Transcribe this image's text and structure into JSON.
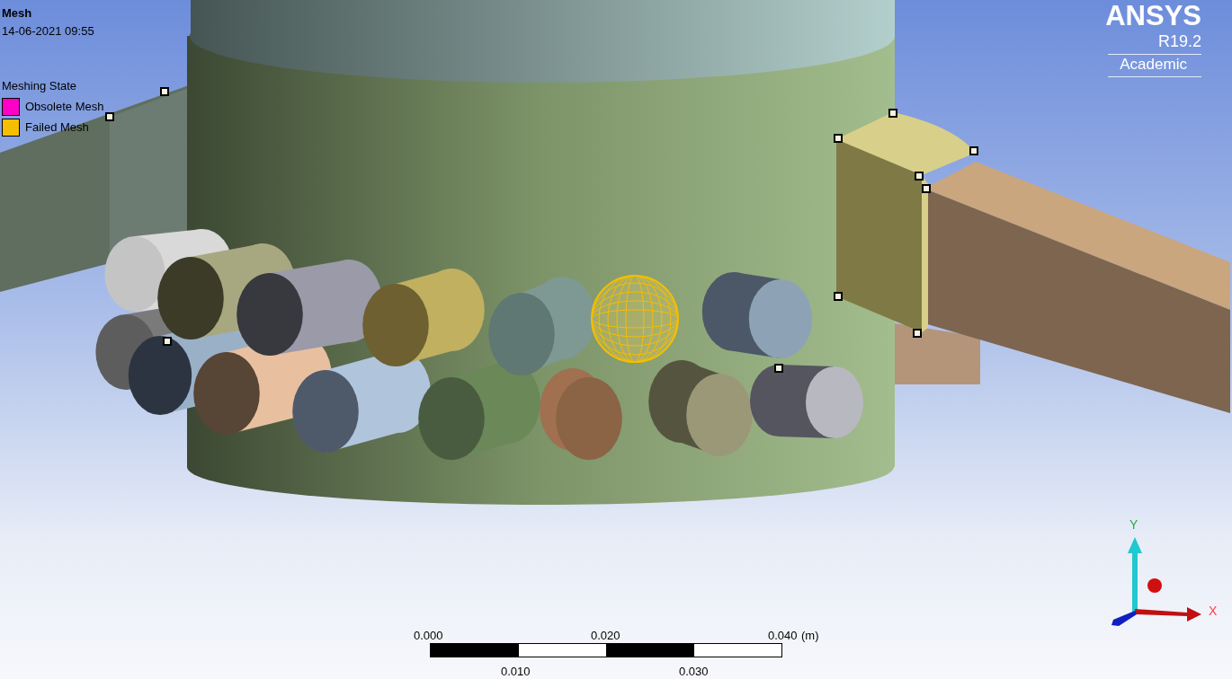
{
  "title": "Mesh",
  "timestamp": "14-06-2021 09:55",
  "legend": {
    "title": "Meshing State",
    "items": [
      {
        "label": "Obsolete Mesh",
        "color": "#ff00c8"
      },
      {
        "label": "Failed Mesh",
        "color": "#f5be00"
      }
    ]
  },
  "logo": {
    "name": "ANSYS",
    "version": "R19.2",
    "edition": "Academic"
  },
  "scale_bar": {
    "top_labels": [
      "0.000",
      "0.020",
      "0.040"
    ],
    "unit": "(m)",
    "bottom_labels": [
      "0.010",
      "0.030"
    ]
  },
  "triad": {
    "y_label": "Y",
    "x_label": "X"
  }
}
